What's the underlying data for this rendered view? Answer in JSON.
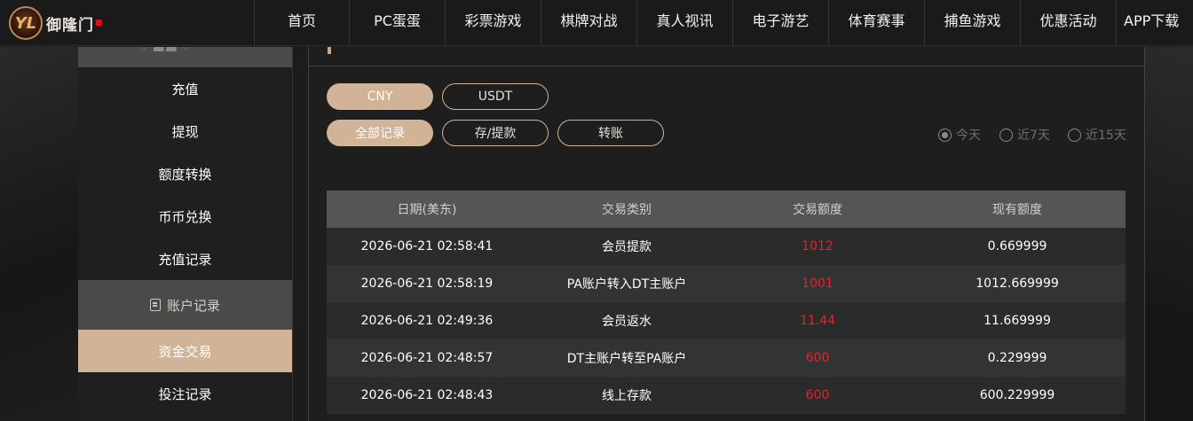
{
  "logo": {
    "mark": "YL",
    "text": "御隆门"
  },
  "nav": [
    {
      "label": "首页"
    },
    {
      "label": "PC蛋蛋"
    },
    {
      "label": "彩票游戏"
    },
    {
      "label": "棋牌对战"
    },
    {
      "label": "真人视讯"
    },
    {
      "label": "电子游艺"
    },
    {
      "label": "体育赛事"
    },
    {
      "label": "捕鱼游戏"
    },
    {
      "label": "优惠活动"
    },
    {
      "label": "APP下载"
    }
  ],
  "sidebar": {
    "items_top": [
      {
        "label": "充值"
      },
      {
        "label": "提现"
      },
      {
        "label": "额度转换"
      },
      {
        "label": "币币兑换"
      },
      {
        "label": "充值记录"
      }
    ],
    "group": {
      "label": "账户记录"
    },
    "items_bottom": [
      {
        "label": "资金交易",
        "active": true
      },
      {
        "label": "投注记录"
      }
    ]
  },
  "currency": [
    {
      "label": "CNY",
      "selected": true
    },
    {
      "label": "USDT",
      "selected": false
    }
  ],
  "record_type": [
    {
      "label": "全部记录",
      "selected": true
    },
    {
      "label": "存/提款",
      "selected": false
    },
    {
      "label": "转账",
      "selected": false
    }
  ],
  "date_range": [
    {
      "label": "今天",
      "selected": true
    },
    {
      "label": "近7天",
      "selected": false
    },
    {
      "label": "近15天",
      "selected": false
    }
  ],
  "table": {
    "headers": [
      "日期(美东)",
      "交易类别",
      "交易额度",
      "现有额度"
    ],
    "rows": [
      [
        "2026-06-21 02:58:41",
        "会员提款",
        "1012",
        "0.669999"
      ],
      [
        "2026-06-21 02:58:19",
        "PA账户转入DT主账户",
        "1001",
        "1012.669999"
      ],
      [
        "2026-06-21 02:49:36",
        "会员返水",
        "11.44",
        "11.669999"
      ],
      [
        "2026-06-21 02:48:57",
        "DT主账户转至PA账户",
        "600",
        "0.229999"
      ],
      [
        "2026-06-21 02:48:43",
        "线上存款",
        "600",
        "600.229999"
      ]
    ]
  },
  "colors": {
    "accent": "#d1b397",
    "amount": "#e0262b",
    "header_bg": "#555555"
  }
}
